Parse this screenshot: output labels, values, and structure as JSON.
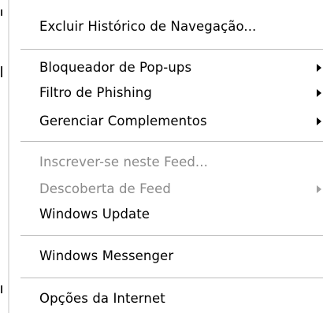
{
  "menu": {
    "items": [
      {
        "label": "Excluir Histórico de Navegação...",
        "enabled": true,
        "has_submenu": false
      },
      {
        "label": "Bloqueador de Pop-ups",
        "enabled": true,
        "has_submenu": true
      },
      {
        "label": "Filtro de Phishing",
        "enabled": true,
        "has_submenu": true
      },
      {
        "label": "Gerenciar Complementos",
        "enabled": true,
        "has_submenu": true
      },
      {
        "label": "Inscrever-se neste Feed...",
        "enabled": false,
        "has_submenu": false
      },
      {
        "label": "Descoberta de Feed",
        "enabled": false,
        "has_submenu": true
      },
      {
        "label": "Windows Update",
        "enabled": true,
        "has_submenu": false
      },
      {
        "label": "Windows Messenger",
        "enabled": true,
        "has_submenu": false
      },
      {
        "label": "Opções da Internet",
        "enabled": true,
        "has_submenu": false
      }
    ],
    "submenu_arrow_icon": "chevron-right-icon",
    "colors": {
      "text": "#000000",
      "disabled_text": "#8a8a8a",
      "separator": "#bdbdbd",
      "background": "#ffffff"
    }
  }
}
